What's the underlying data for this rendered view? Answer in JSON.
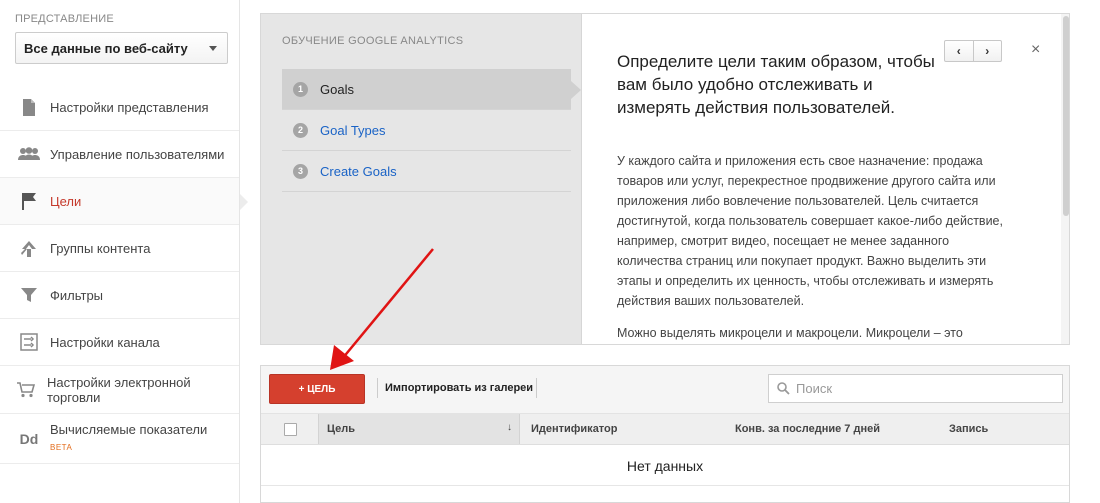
{
  "sidebar": {
    "view_label": "ПРЕДСТАВЛЕНИЕ",
    "view_select": "Все данные по веб-сайту",
    "items": [
      {
        "label": "Настройки представления",
        "icon": "document-icon"
      },
      {
        "label": "Управление пользователями",
        "icon": "users-icon"
      },
      {
        "label": "Цели",
        "icon": "flag-icon",
        "active": true
      },
      {
        "label": "Группы контента",
        "icon": "content-group-icon"
      },
      {
        "label": "Фильтры",
        "icon": "filter-icon"
      },
      {
        "label": "Настройки канала",
        "icon": "channel-settings-icon"
      },
      {
        "label": "Настройки электронной торговли",
        "icon": "ecommerce-icon"
      },
      {
        "label": "Вычисляемые показатели",
        "icon": "dd-icon",
        "badge": "BETA",
        "icon_text": "Dd"
      }
    ]
  },
  "tutorial": {
    "heading": "ОБУЧЕНИЕ GOOGLE ANALYTICS",
    "steps": [
      {
        "num": "1",
        "label": "Goals",
        "active": true
      },
      {
        "num": "2",
        "label": "Goal Types"
      },
      {
        "num": "3",
        "label": "Create Goals"
      }
    ],
    "title": "Определите цели таким образом, чтобы вам было удобно отслеживать и измерять действия пользователей.",
    "body_1": "У каждого сайта и приложения есть свое назначение: продажа товаров или услуг, перекрестное продвижение другого сайта или приложения либо вовлечение пользователей. Цель считается достигнутой, когда пользователь совершает какое-либо действие, например, смотрит видео, посещает не менее заданного количества страниц или покупает продукт. Важно выделить эти этапы и определить их ценность, чтобы отслеживать и измерять действия ваших пользователей.",
    "body_2": "Можно выделять микроцели и макроцели. Микроцели – это",
    "prev": "‹",
    "next": "›",
    "close": "×"
  },
  "toolbar": {
    "new_goal": "+ ЦЕЛЬ",
    "import": "Импортировать из галереи",
    "search_placeholder": "Поиск"
  },
  "table": {
    "columns": [
      "Цель",
      "Идентификатор",
      "Конв. за последние 7 дней",
      "Запись"
    ],
    "sort_indicator": "↓",
    "empty": "Нет данных"
  },
  "colors": {
    "accent_red": "#d5402e",
    "link_blue": "#1a63c6",
    "active_nav": "#c5392b"
  }
}
